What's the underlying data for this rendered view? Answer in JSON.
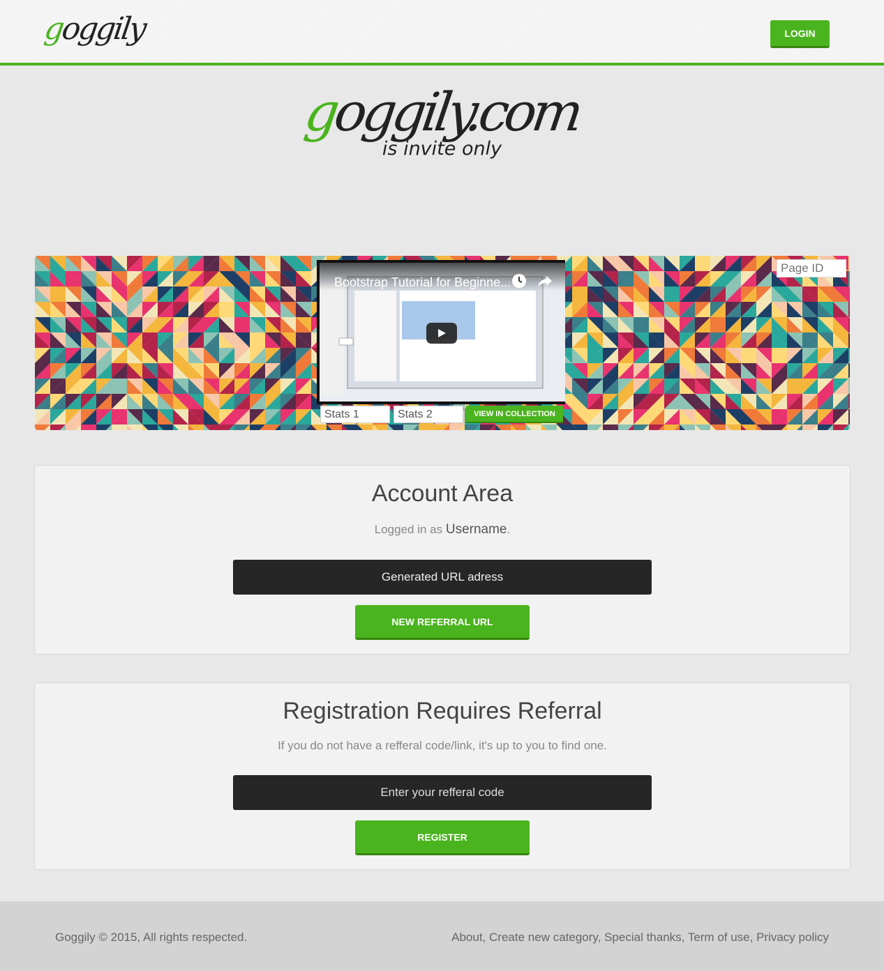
{
  "navbar": {
    "logo_first": "g",
    "logo_rest": "oggily",
    "login_label": "LOGIN"
  },
  "hero": {
    "logo_first": "g",
    "logo_rest": "oggily.com",
    "tagline": "is invite only"
  },
  "banner": {
    "page_id_placeholder": "Page ID",
    "video_title": "Bootstrap Tutorial for Beginne...",
    "stats1": "Stats 1",
    "stats2": "Stats 2",
    "view_label": "VIEW IN COLLECTION"
  },
  "account": {
    "title": "Account Area",
    "logged_prefix": "Logged in as ",
    "username": "Username",
    "logged_suffix": ".",
    "url_field": "Generated URL adress",
    "new_referral_label": "NEW REFERRAL URL"
  },
  "registration": {
    "title": "Registration Requires Referral",
    "subtitle": "If you do not have a refferal code/link, it's up to you to find one.",
    "code_placeholder": "Enter your refferal code",
    "register_label": "REGISTER"
  },
  "footer": {
    "copyright": "Goggily © 2015, All rights respected.",
    "links": [
      "About",
      "Create new category",
      "Special thanks",
      "Term of use",
      "Privacy policy"
    ]
  },
  "colors": {
    "accent": "#4ab41e",
    "dark_field": "#262626"
  }
}
